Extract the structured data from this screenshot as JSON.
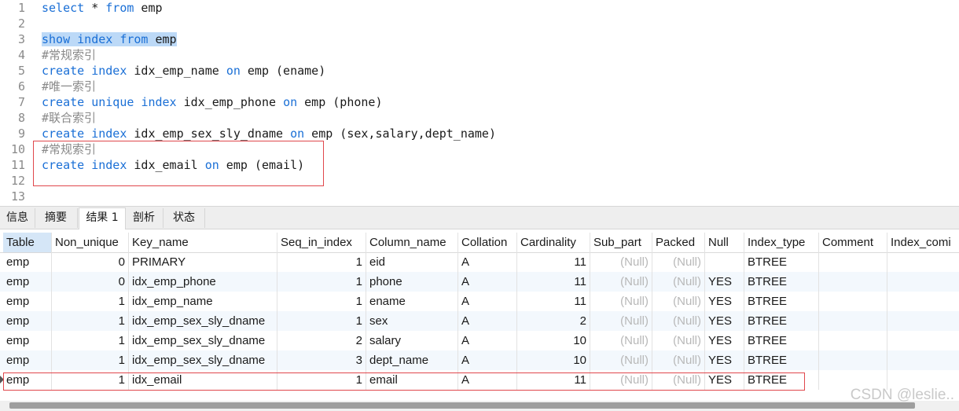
{
  "editor": {
    "lines": [
      {
        "n": "1",
        "segs": [
          {
            "t": "select",
            "k": "kw"
          },
          {
            "t": " * ",
            "k": ""
          },
          {
            "t": "from",
            "k": "kw"
          },
          {
            "t": " emp",
            "k": ""
          }
        ]
      },
      {
        "n": "2",
        "segs": []
      },
      {
        "n": "3",
        "segs": [
          {
            "t": "show",
            "k": "kw hl"
          },
          {
            "t": " ",
            "k": "hl"
          },
          {
            "t": "index",
            "k": "kw hl"
          },
          {
            "t": " ",
            "k": "hl"
          },
          {
            "t": "from",
            "k": "kw hl"
          },
          {
            "t": " emp",
            "k": "hl"
          }
        ]
      },
      {
        "n": "4",
        "segs": [
          {
            "t": "#常规索引",
            "k": "cm"
          }
        ]
      },
      {
        "n": "5",
        "segs": [
          {
            "t": "create",
            "k": "kw"
          },
          {
            "t": " ",
            "k": ""
          },
          {
            "t": "index",
            "k": "kw"
          },
          {
            "t": " idx_emp_name ",
            "k": ""
          },
          {
            "t": "on",
            "k": "kw"
          },
          {
            "t": " emp (ename)",
            "k": ""
          }
        ]
      },
      {
        "n": "6",
        "segs": [
          {
            "t": "#唯一索引",
            "k": "cm"
          }
        ]
      },
      {
        "n": "7",
        "segs": [
          {
            "t": "create",
            "k": "kw"
          },
          {
            "t": " ",
            "k": ""
          },
          {
            "t": "unique",
            "k": "kw"
          },
          {
            "t": " ",
            "k": ""
          },
          {
            "t": "index",
            "k": "kw"
          },
          {
            "t": " idx_emp_phone ",
            "k": ""
          },
          {
            "t": "on",
            "k": "kw"
          },
          {
            "t": " emp (phone)",
            "k": ""
          }
        ]
      },
      {
        "n": "8",
        "segs": [
          {
            "t": "#联合索引",
            "k": "cm"
          }
        ]
      },
      {
        "n": "9",
        "segs": [
          {
            "t": "create",
            "k": "kw"
          },
          {
            "t": " ",
            "k": ""
          },
          {
            "t": "index",
            "k": "kw"
          },
          {
            "t": " idx_emp_sex_sly_dname ",
            "k": ""
          },
          {
            "t": "on",
            "k": "kw"
          },
          {
            "t": " emp (sex,salary,dept_name)",
            "k": ""
          }
        ]
      },
      {
        "n": "10",
        "segs": [
          {
            "t": "#常规索引",
            "k": "cm"
          }
        ]
      },
      {
        "n": "11",
        "segs": [
          {
            "t": "create",
            "k": "kw"
          },
          {
            "t": " ",
            "k": ""
          },
          {
            "t": "index",
            "k": "kw"
          },
          {
            "t": " idx_email ",
            "k": ""
          },
          {
            "t": "on",
            "k": "kw"
          },
          {
            "t": " emp (email)",
            "k": ""
          }
        ]
      },
      {
        "n": "12",
        "segs": []
      },
      {
        "n": "13",
        "segs": []
      }
    ]
  },
  "tabs": [
    {
      "label": "信息",
      "active": false
    },
    {
      "label": "摘要",
      "active": false
    },
    {
      "label": "结果 1",
      "active": true
    },
    {
      "label": "剖析",
      "active": false
    },
    {
      "label": "状态",
      "active": false
    }
  ],
  "result": {
    "columns": [
      "Table",
      "Non_unique",
      "Key_name",
      "Seq_in_index",
      "Column_name",
      "Collation",
      "Cardinality",
      "Sub_part",
      "Packed",
      "Null",
      "Index_type",
      "Comment",
      "Index_comi"
    ],
    "rows": [
      [
        "emp",
        "0",
        "PRIMARY",
        "1",
        "eid",
        "A",
        "11",
        "(Null)",
        "(Null)",
        "",
        "BTREE",
        "",
        ""
      ],
      [
        "emp",
        "0",
        "idx_emp_phone",
        "1",
        "phone",
        "A",
        "11",
        "(Null)",
        "(Null)",
        "YES",
        "BTREE",
        "",
        ""
      ],
      [
        "emp",
        "1",
        "idx_emp_name",
        "1",
        "ename",
        "A",
        "11",
        "(Null)",
        "(Null)",
        "YES",
        "BTREE",
        "",
        ""
      ],
      [
        "emp",
        "1",
        "idx_emp_sex_sly_dname",
        "1",
        "sex",
        "A",
        "2",
        "(Null)",
        "(Null)",
        "YES",
        "BTREE",
        "",
        ""
      ],
      [
        "emp",
        "1",
        "idx_emp_sex_sly_dname",
        "2",
        "salary",
        "A",
        "10",
        "(Null)",
        "(Null)",
        "YES",
        "BTREE",
        "",
        ""
      ],
      [
        "emp",
        "1",
        "idx_emp_sex_sly_dname",
        "3",
        "dept_name",
        "A",
        "10",
        "(Null)",
        "(Null)",
        "YES",
        "BTREE",
        "",
        ""
      ],
      [
        "emp",
        "1",
        "idx_email",
        "1",
        "email",
        "A",
        "11",
        "(Null)",
        "(Null)",
        "YES",
        "BTREE",
        "",
        ""
      ]
    ]
  },
  "watermark": "CSDN @leslie..",
  "colors": {
    "keyword": "#1a6fd6",
    "comment": "#8a8a8a",
    "highlight": "#bcd9f7",
    "annotation_box": "#e0474c"
  }
}
